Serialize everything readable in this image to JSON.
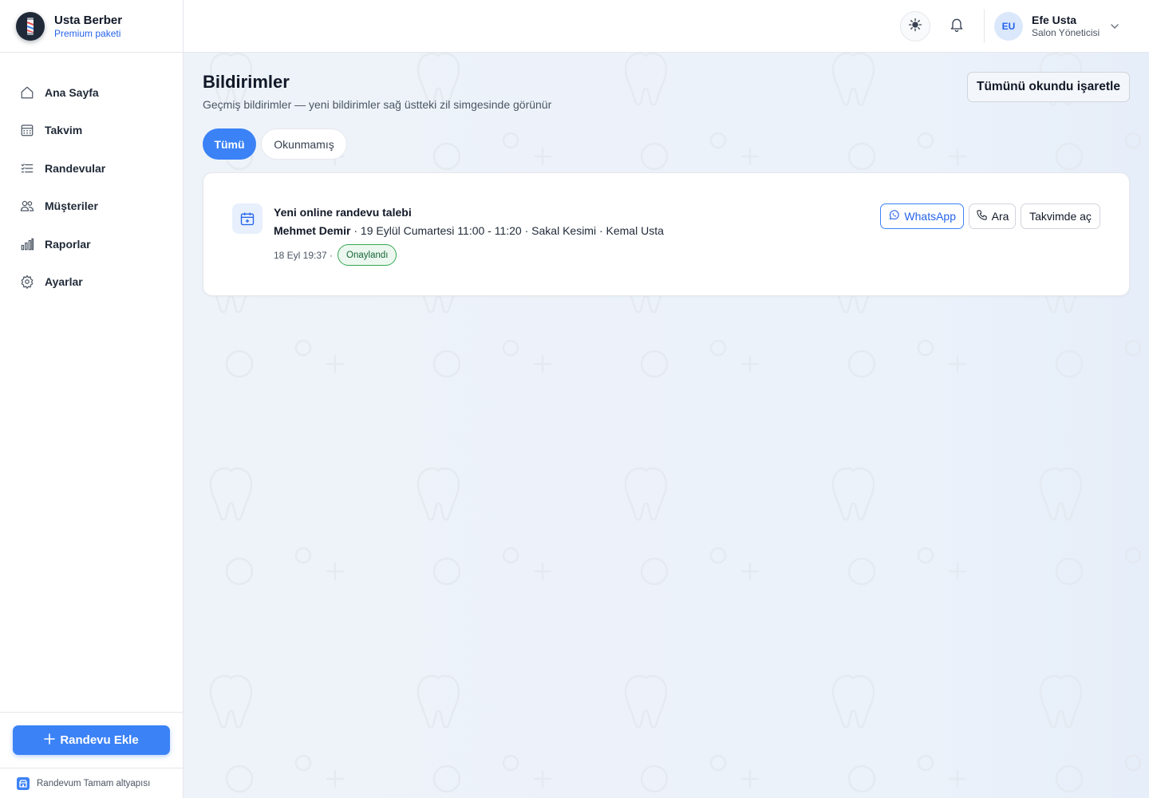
{
  "brand": {
    "name": "Usta Berber",
    "plan": "Premium paketi"
  },
  "sidebar": {
    "items": [
      {
        "label": "Ana Sayfa",
        "icon": "home-icon"
      },
      {
        "label": "Takvim",
        "icon": "calendar-icon"
      },
      {
        "label": "Randevular",
        "icon": "list-icon"
      },
      {
        "label": "Müşteriler",
        "icon": "users-icon"
      },
      {
        "label": "Raporlar",
        "icon": "bar-chart-icon"
      },
      {
        "label": "Ayarlar",
        "icon": "gear-icon"
      }
    ],
    "add_button": "Randevu Ekle",
    "powered_by": "Randevum Tamam altyapısı"
  },
  "header": {
    "user": {
      "initials": "EU",
      "name": "Efe Usta",
      "role": "Salon Yöneticisi"
    }
  },
  "page": {
    "title": "Bildirimler",
    "subtitle": "Geçmiş bildirimler — yeni bildirimler sağ üstteki zil simgesinde görünür",
    "mark_all_read": "Tümünü okundu işaretle",
    "tabs": [
      {
        "label": "Tümü",
        "active": true
      },
      {
        "label": "Okunmamış",
        "active": false
      }
    ]
  },
  "notifications": [
    {
      "title": "Yeni online randevu talebi",
      "customer": "Mehmet Demir",
      "details": " · 19 Eylül Cumartesi 11:00 - 11:20 · Sakal Kesimi · Kemal Usta",
      "time": "18 Eyl 19:37 ·",
      "status": "Onaylandı",
      "actions": {
        "whatsapp": "WhatsApp",
        "call": "Ara",
        "calendar": "Takvimde aç"
      }
    }
  ],
  "colors": {
    "accent": "#3b82f6",
    "success": "#34a853",
    "background": "#eef3f9"
  }
}
